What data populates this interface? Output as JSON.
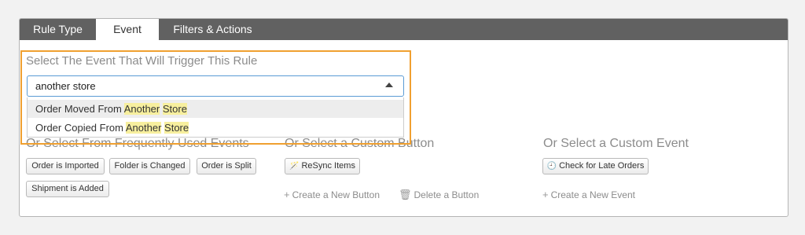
{
  "tabs": [
    {
      "label": "Rule Type"
    },
    {
      "label": "Event"
    },
    {
      "label": "Filters & Actions"
    }
  ],
  "event_select": {
    "label": "Select The Event That Will Trigger This Rule",
    "value": "another store",
    "options": [
      {
        "prefix": "Order Moved From ",
        "match1": "Another",
        "mid": " ",
        "match2": "Store"
      },
      {
        "prefix": "Order Copied From ",
        "match1": "Another",
        "mid": " ",
        "match2": "Store"
      }
    ]
  },
  "frequent": {
    "label": "Or Select From Frequently Used Events",
    "buttons": [
      "Order is Imported",
      "Folder is Changed",
      "Order is Split",
      "Shipment is Added"
    ]
  },
  "custom_button": {
    "label": "Or Select a Custom Button",
    "resync_label": "ReSync Items",
    "create_label": "Create a New Button",
    "delete_label": "Delete a Button"
  },
  "custom_event": {
    "label": "Or Select a Custom Event",
    "late_label": "Check for Late Orders",
    "create_label": "Create a New Event"
  },
  "colors": {
    "accent": "#f0a030",
    "tabbar": "#616161",
    "highlight": "#f7ef9e",
    "focus": "#5b9bd5"
  }
}
